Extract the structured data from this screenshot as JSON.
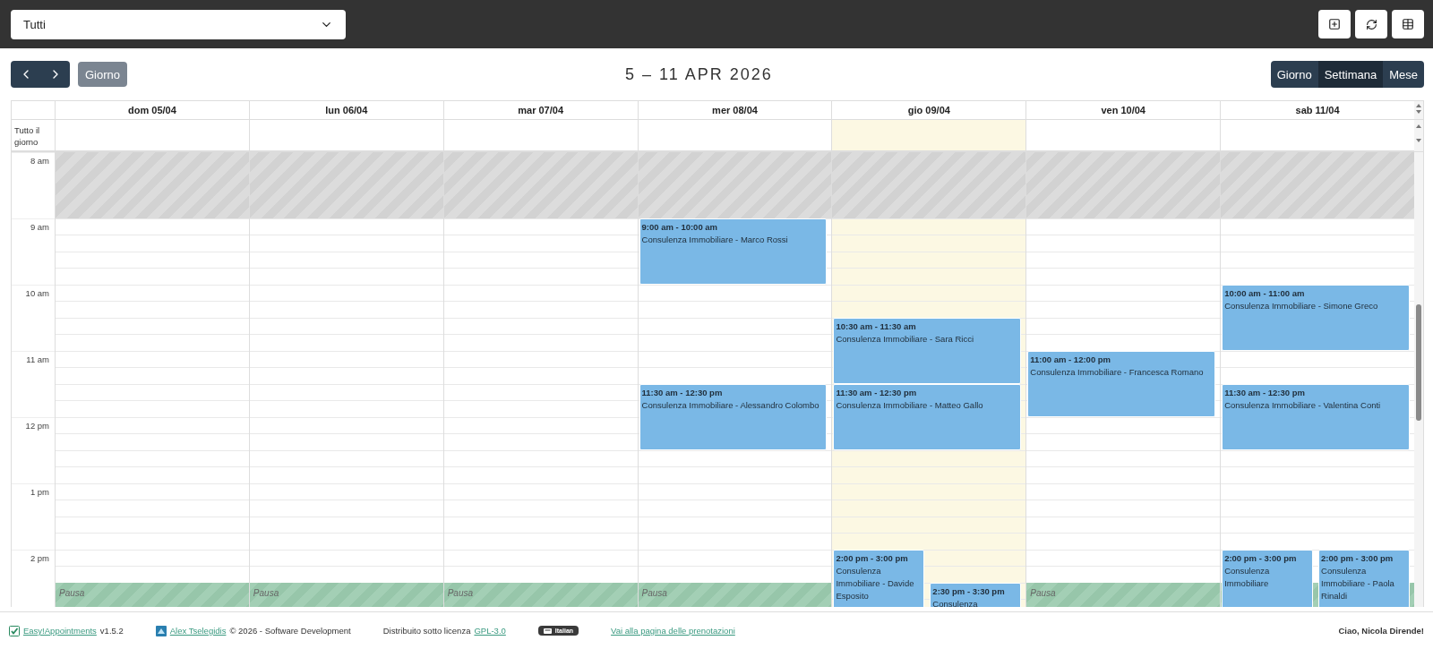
{
  "top_bar": {
    "provider_select": {
      "value": "Tutti"
    },
    "buttons": [
      {
        "kind": "add"
      },
      {
        "kind": "reload"
      },
      {
        "kind": "table"
      }
    ]
  },
  "toolbar": {
    "today_button": "Giorno",
    "title": "5 – 11 APR 2026",
    "views": [
      {
        "label": "Giorno",
        "selected": false
      },
      {
        "label": "Settimana",
        "selected": true
      },
      {
        "label": "Mese",
        "selected": false
      }
    ]
  },
  "calendar": {
    "all_day_label": "Tutto il giorno",
    "hours": [
      {
        "label": "8 am",
        "unavailable": true
      },
      {
        "label": "9 am"
      },
      {
        "label": "10 am"
      },
      {
        "label": "11 am"
      },
      {
        "label": "12 pm"
      },
      {
        "label": "1 pm"
      },
      {
        "label": "2 pm",
        "break_at_half": true
      }
    ],
    "days": [
      {
        "label": "dom 05/04",
        "today": false,
        "on_break": true,
        "break_label": "Pausa"
      },
      {
        "label": "lun 06/04",
        "today": false,
        "on_break": true,
        "break_label": "Pausa"
      },
      {
        "label": "mar 07/04",
        "today": false,
        "on_break": true,
        "break_label": "Pausa"
      },
      {
        "label": "mer 08/04",
        "today": false,
        "on_break": true,
        "break_label": "Pausa",
        "events": [
          {
            "time": "9:00 am - 10:00 am",
            "title": "Consulenza Immobiliare - Marco Rossi"
          },
          {
            "time": "11:30 am - 12:30 pm",
            "title": "Consulenza Immobiliare - Alessandro Colombo"
          }
        ]
      },
      {
        "label": "gio 09/04",
        "today": true,
        "on_break": false,
        "events": [
          {
            "time": "10:30 am - 11:30 am",
            "title": "Consulenza Immobiliare - Sara Ricci"
          },
          {
            "time": "11:30 am - 12:30 pm",
            "title": "Consulenza Immobiliare - Matteo Gallo"
          },
          {
            "time": "2:00 pm - 3:00 pm",
            "title": "Consulenza Immobiliare - Davide Esposito"
          },
          {
            "time": "2:30 pm - 3:30 pm",
            "title": "Consulenza"
          }
        ]
      },
      {
        "label": "ven 10/04",
        "today": false,
        "on_break": true,
        "break_label": "Pausa",
        "events": [
          {
            "time": "11:00 am - 12:00 pm",
            "title": "Consulenza Immobiliare - Francesca Romano"
          }
        ]
      },
      {
        "label": "sab 11/04",
        "today": false,
        "on_break": true,
        "events": [
          {
            "time": "10:00 am - 11:00 am",
            "title": "Consulenza Immobiliare - Simone Greco"
          },
          {
            "time": "11:30 am - 12:30 pm",
            "title": "Consulenza Immobiliare - Valentina Conti"
          },
          {
            "time": "2:00 pm - 3:00 pm",
            "title": "Consulenza Immobiliare"
          },
          {
            "time": "2:00 pm - 3:00 pm",
            "title": "Consulenza Immobiliare - Paola Rinaldi"
          }
        ]
      }
    ]
  },
  "footer": {
    "app_link": "Easy!Appointments",
    "version": "v1.5.2",
    "author_link": "Alex Tselegidis",
    "copyright": "© 2026 - Software Development",
    "license_text": "Distribuito sotto licenza",
    "license_link": "GPL-3.0",
    "language": "Italian",
    "booking_link": "Vai alla pagina delle prenotazioni",
    "greeting": "Ciao, Nicola Dirende!"
  }
}
